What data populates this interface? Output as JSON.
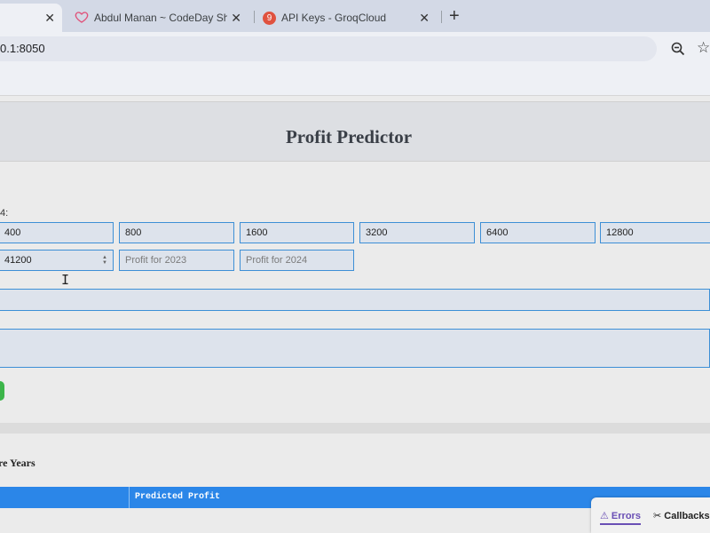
{
  "browser": {
    "tabs": [
      {
        "title": "",
        "close": "✕"
      },
      {
        "title": "Abdul Manan ~ CodeDay Show",
        "close": "✕"
      },
      {
        "title": "API Keys - GroqCloud",
        "close": "✕",
        "badge": "9"
      }
    ],
    "new_tab": "+",
    "url": "0.1:8050"
  },
  "page": {
    "title": "Profit Predictor",
    "years_label": "4:",
    "profit_inputs": [
      "400",
      "800",
      "1600",
      "3200",
      "6400",
      "12800"
    ],
    "stepper_value": "41200",
    "placeholder_2023": "Profit for 2023",
    "placeholder_2024": "Profit for 2024",
    "section_heading": "re Years",
    "table": {
      "columns": [
        "",
        "Predicted Profit"
      ]
    }
  },
  "debug": {
    "errors": "⚠ Errors",
    "callbacks": "✂ Callbacks"
  },
  "colors": {
    "accent": "#2b86e8",
    "button": "#3cb54a",
    "input_border": "#3d8fd6"
  }
}
